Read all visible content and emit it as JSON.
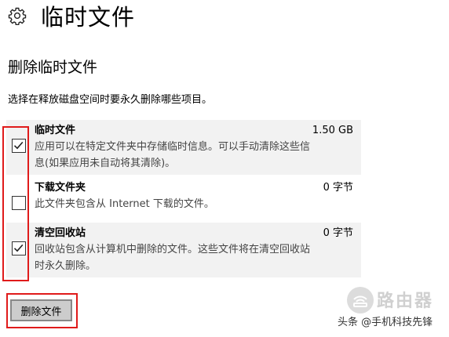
{
  "header": {
    "icon": "gear-icon",
    "title": "临时文件"
  },
  "section": {
    "title": "删除临时文件",
    "description": "选择在释放磁盘空间时要永久删除哪些项目。"
  },
  "items": [
    {
      "name": "临时文件",
      "size": "1.50 GB",
      "description_line1": "应用可以在特定文件夹中存储临时信息。可以手动清除这些信",
      "description_line2": "息(如果应用未自动将其清除)。",
      "checked": true
    },
    {
      "name": "下载文件夹",
      "size": "0 字节",
      "description_line1": "此文件夹包含从 Internet 下载的文件。",
      "checked": false
    },
    {
      "name": "清空回收站",
      "size": "0 字节",
      "description_line1": "回收站包含从计算机中删除的文件。这些文件将在清空回收站",
      "description_line2": "时永久删除。",
      "checked": true
    }
  ],
  "actions": {
    "delete_label": "删除文件"
  },
  "watermark": {
    "brand": "路由器",
    "author": "头条 @手机科技先锋"
  },
  "colors": {
    "highlight": "#e01b1b",
    "item_bg": "#f2f2f2",
    "button_bg": "#cccccc"
  }
}
